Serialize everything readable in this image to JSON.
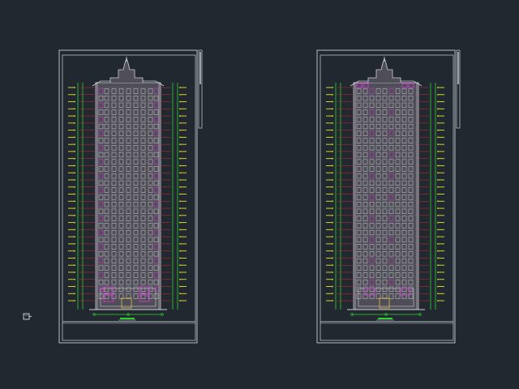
{
  "viewport": {
    "background": "#212830"
  },
  "colors": {
    "frame": "#b8bcc2",
    "facade_fill": "#4f4d57",
    "window": "#cfcfd6",
    "accent": "#d23cd2",
    "dim_red": "#d12a2a",
    "dim_green": "#2fd02f",
    "dim_yellow": "#e6e62a",
    "title_block": "#9aa0a7"
  },
  "drawings": [
    {
      "id": "elevation-left"
    },
    {
      "id": "elevation-right"
    }
  ],
  "icons": {
    "ucs": "ucs-axis-icon"
  }
}
